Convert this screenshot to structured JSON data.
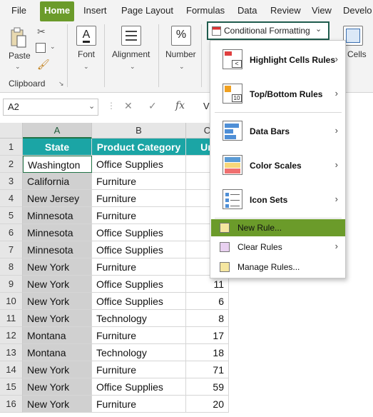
{
  "menu": {
    "items": [
      "File",
      "Home",
      "Insert",
      "Page Layout",
      "Formulas",
      "Data",
      "Review",
      "View",
      "Develo"
    ],
    "active": "Home"
  },
  "ribbon": {
    "paste": "Paste",
    "clipboard": "Clipboard",
    "font": "Font",
    "alignment": "Alignment",
    "number": "Number",
    "number_symbol": "%",
    "font_symbol": "A",
    "cells": "Cells",
    "cond_format": "Conditional Formatting",
    "cond_format_caret": "⌄"
  },
  "formula_bar": {
    "name_box": "A2",
    "cancel": "✕",
    "enter": "✓",
    "fx": "fx",
    "content_fragment": "V"
  },
  "grid": {
    "columns": [
      "A",
      "B",
      "C"
    ],
    "rows": [
      "1",
      "2",
      "3",
      "4",
      "5",
      "6",
      "7",
      "8",
      "9",
      "10",
      "11",
      "12",
      "13",
      "14",
      "15",
      "16"
    ],
    "headers": [
      "State",
      "Product Category",
      "Un"
    ],
    "data": [
      [
        "Washington",
        "Office Supplies",
        ""
      ],
      [
        "California",
        "Furniture",
        ""
      ],
      [
        "New Jersey",
        "Furniture",
        ""
      ],
      [
        "Minnesota",
        "Furniture",
        ""
      ],
      [
        "Minnesota",
        "Office Supplies",
        ""
      ],
      [
        "Minnesota",
        "Office Supplies",
        ""
      ],
      [
        "New York",
        "Furniture",
        ""
      ],
      [
        "New York",
        "Office Supplies",
        "11"
      ],
      [
        "New York",
        "Office Supplies",
        "6"
      ],
      [
        "New York",
        "Technology",
        "8"
      ],
      [
        "Montana",
        "Furniture",
        "17"
      ],
      [
        "Montana",
        "Technology",
        "18"
      ],
      [
        "New York",
        "Furniture",
        "71"
      ],
      [
        "New York",
        "Office Supplies",
        "59"
      ],
      [
        "New York",
        "Furniture",
        "20"
      ]
    ]
  },
  "dropdown": {
    "highlight_cells": "Highlight Cells Rules",
    "top_bottom": "Top/Bottom Rules",
    "data_bars": "Data Bars",
    "color_scales": "Color Scales",
    "icon_sets": "Icon Sets",
    "new_rule": "New Rule...",
    "clear_rules": "Clear Rules",
    "manage_rules": "Manage Rules...",
    "arrow": "›"
  },
  "colors": {
    "accent_green": "#6b9b2a",
    "header_teal": "#1ba5a5",
    "selection_green": "#217346"
  }
}
